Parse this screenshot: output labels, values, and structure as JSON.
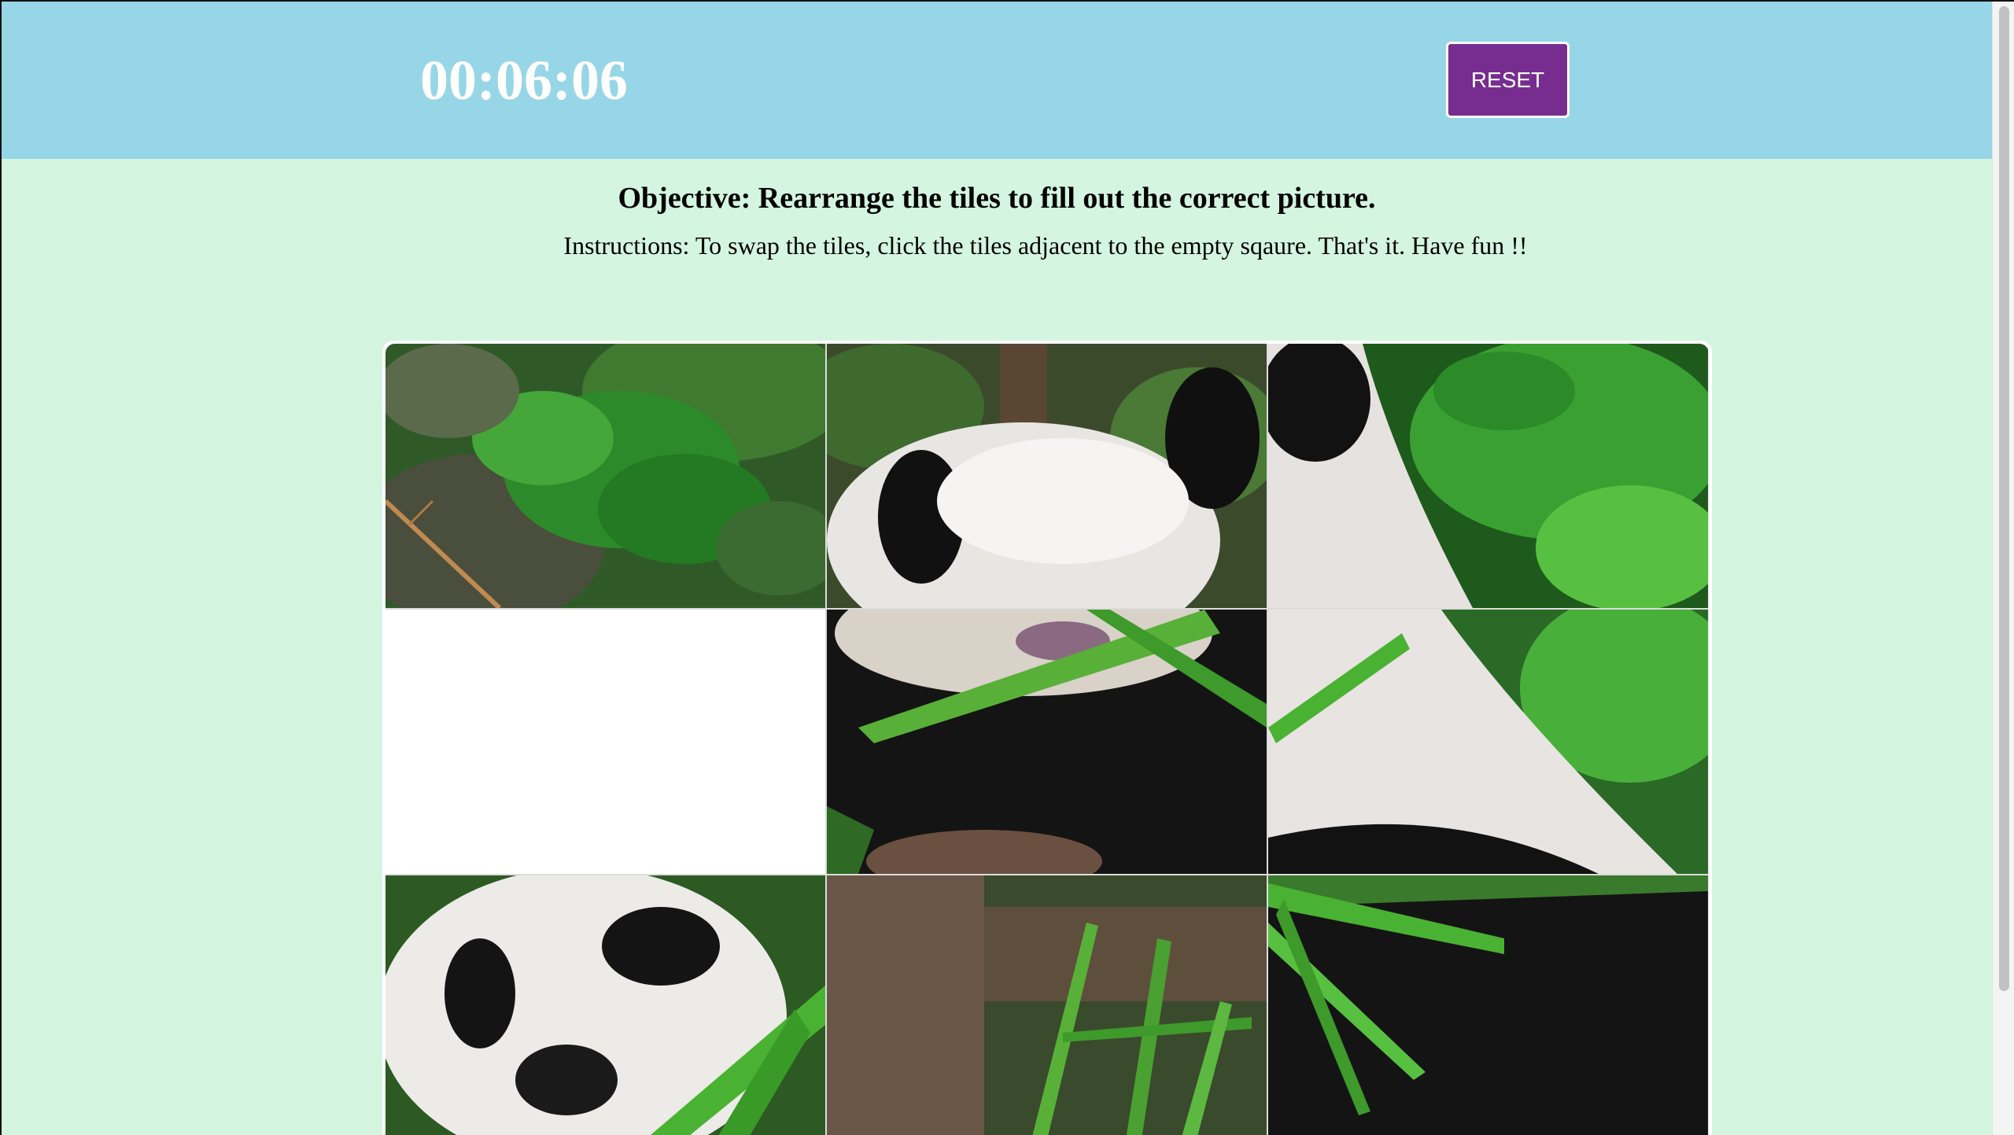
{
  "header": {
    "timer": "00:06:06",
    "reset_label": "RESET"
  },
  "content": {
    "objective": "Objective: Rearrange the tiles to fill out the correct picture.",
    "instructions": "Instructions: To swap the tiles, click the tiles adjacent to the empty sqaure. That's it. Have fun !!"
  },
  "puzzle": {
    "rows": 3,
    "cols": 3,
    "empty_tile_row": 2,
    "empty_tile_col": 1,
    "tiles": [
      {
        "content": "green foliage with twig"
      },
      {
        "content": "panda head top with ear"
      },
      {
        "content": "green leaves and panda back"
      },
      {
        "content": "empty"
      },
      {
        "content": "panda mouth eating bamboo"
      },
      {
        "content": "panda shoulder with leaves"
      },
      {
        "content": "panda face close-up"
      },
      {
        "content": "log and bamboo stalks"
      },
      {
        "content": "panda body with bamboo leaves"
      }
    ]
  },
  "colors": {
    "header_bg": "#96d6e7",
    "page_bg": "#d4f5df",
    "reset_bg": "#772d8f",
    "text": "#000000"
  }
}
